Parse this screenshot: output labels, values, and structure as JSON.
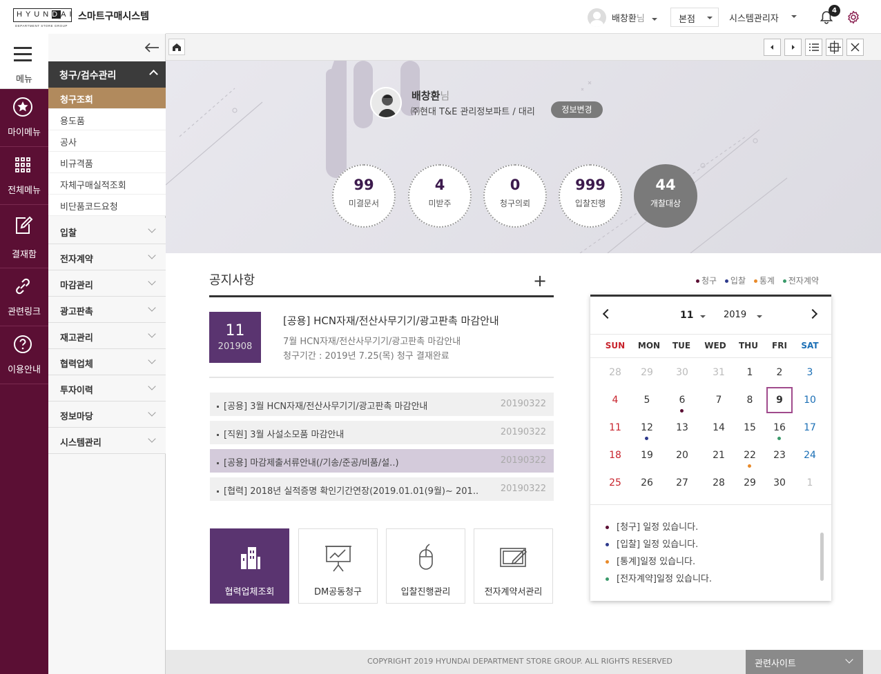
{
  "header": {
    "logo_text": "HYUNDAI",
    "logo_sub": "DEPARTMENT STORE GROUP",
    "system_name": "스마트구매시스템",
    "user_name": "배창환",
    "user_suffix": "님",
    "branch": "본점",
    "role": "시스템관리자",
    "notification_count": "4"
  },
  "leftbar": {
    "menu_label": "메뉴",
    "items": [
      {
        "label": "마이메뉴",
        "icon": "star-icon"
      },
      {
        "label": "전체메뉴",
        "icon": "grid-icon"
      },
      {
        "label": "결재함",
        "icon": "edit-icon"
      },
      {
        "label": "관련링크",
        "icon": "link-icon"
      },
      {
        "label": "이용안내",
        "icon": "help-icon"
      }
    ]
  },
  "subnav": {
    "header": "청구/검수관리",
    "sub_items": [
      "청구조회",
      "용도품",
      "공사",
      "비규격품",
      "자체구매실적조회",
      "비단품코드요청"
    ],
    "active_index": 0,
    "groups": [
      "입찰",
      "전자계약",
      "마감관리",
      "광고판촉",
      "재고관리",
      "협력업체",
      "투자이력",
      "정보마당",
      "시스템관리"
    ]
  },
  "profile": {
    "name": "배창환",
    "suffix": "님",
    "org": "㈜현대 T&E 관리정보파트 / 대리",
    "edit_label": "정보변경"
  },
  "stats": [
    {
      "value": "99",
      "label": "미결문서"
    },
    {
      "value": "4",
      "label": "미받주"
    },
    {
      "value": "0",
      "label": "청구의뢰"
    },
    {
      "value": "999",
      "label": "입찰진행"
    },
    {
      "value": "44",
      "label": "개찰대상"
    }
  ],
  "notice": {
    "title": "공지사항",
    "plus": "+",
    "featured": {
      "day": "11",
      "yearmonth": "201908",
      "title": "[공용] HCN자재/전산사무기기/광고판촉 마감안내",
      "desc1": "7월 HCN자재/전산사무기기/광고판촉 마감안내",
      "desc2": "청구기간 : 2019년 7.25(목) 청구 결재완료"
    },
    "rows": [
      {
        "text": "[공용] 3월 HCN자재/전산사무기기/광고판촉 마감안내",
        "date": "20190322"
      },
      {
        "text": "[직원] 3월 사설소모품 마감안내",
        "date": "20190322"
      },
      {
        "text": "[공용] 마감제출서류안내(/기송/준공/비품/설..)",
        "date": "20190322"
      },
      {
        "text": "[협력] 2018년 실적증명 확인기간연장(2019.01.01(9월)~ 201..",
        "date": "20190322"
      }
    ]
  },
  "quick_buttons": [
    "협력업체조회",
    "DM공동청구",
    "입찰진행관리",
    "전자계약서관리"
  ],
  "calendar": {
    "legend": [
      {
        "label": "청구",
        "color": "#5b0f34"
      },
      {
        "label": "입찰",
        "color": "#2e3a8c"
      },
      {
        "label": "통계",
        "color": "#e88a2a"
      },
      {
        "label": "전자계약",
        "color": "#3a9a6a"
      }
    ],
    "month": "11",
    "year": "2019",
    "weekdays": [
      "SUN",
      "MON",
      "TUE",
      "WED",
      "THU",
      "FRI",
      "SAT"
    ],
    "weeks": [
      [
        "28",
        "29",
        "30",
        "31",
        "1",
        "2",
        "3"
      ],
      [
        "4",
        "5",
        "6",
        "7",
        "8",
        "9",
        "10"
      ],
      [
        "11",
        "12",
        "13",
        "14",
        "15",
        "16",
        "17"
      ],
      [
        "18",
        "19",
        "20",
        "21",
        "22",
        "23",
        "24"
      ],
      [
        "25",
        "26",
        "27",
        "28",
        "29",
        "30",
        "1"
      ]
    ],
    "today": "9",
    "events": [
      "[청구] 일정 있습니다.",
      "[입찰] 일정 있습니다.",
      "[통계]일정 있습니다.",
      "[전자계약]일정 있습니다."
    ]
  },
  "footer": {
    "copyright": "COPYRIGHT 2019 HYUNDAI DEPARTMENT STORE GROUP. ALL RIGHTS RESERVED",
    "related": "관련사이트"
  }
}
